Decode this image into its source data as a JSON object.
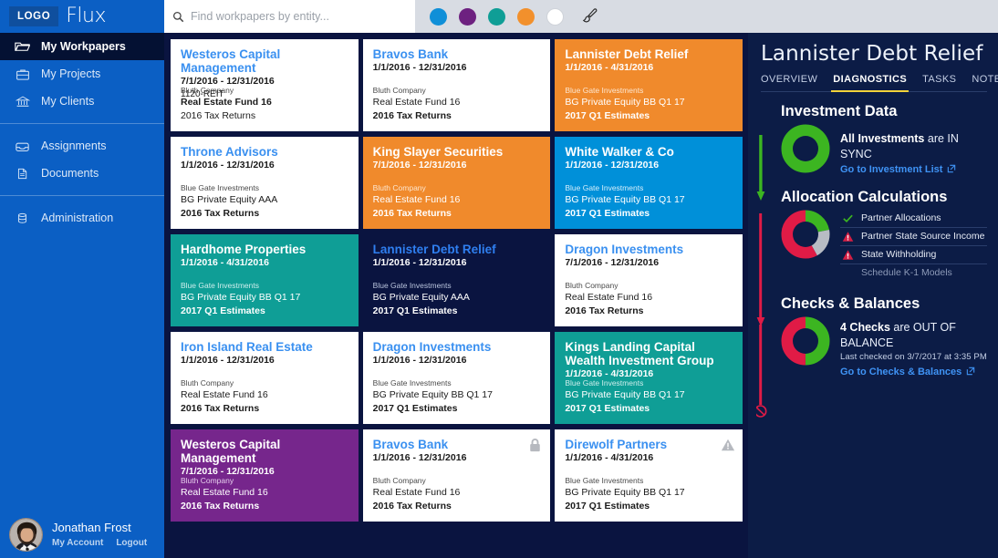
{
  "topbar": {
    "logo_label": "LOGO",
    "brand_name": "Flux",
    "search": {
      "placeholder": "Find workpapers by entity...",
      "value": "",
      "icon": "search-icon"
    },
    "swatches": [
      {
        "name": "swatch-blue",
        "color": "#0f8fd8"
      },
      {
        "name": "swatch-purple",
        "color": "#6d2180"
      },
      {
        "name": "swatch-teal",
        "color": "#0f9e96"
      },
      {
        "name": "swatch-orange",
        "color": "#f2902c"
      },
      {
        "name": "swatch-white",
        "color": "#ffffff"
      }
    ],
    "brush_icon": "paintbrush-icon"
  },
  "sidebar": {
    "items": [
      {
        "label": "My Workpapers",
        "icon": "folder-icon",
        "active": true
      },
      {
        "label": "My Projects",
        "icon": "briefcase-icon",
        "active": false
      },
      {
        "label": "My Clients",
        "icon": "bank-icon",
        "active": false
      },
      {
        "label": "Assignments",
        "icon": "inbox-icon",
        "active": false
      },
      {
        "label": "Documents",
        "icon": "document-icon",
        "active": false
      },
      {
        "label": "Administration",
        "icon": "database-icon",
        "active": false
      }
    ],
    "profile": {
      "name": "Jonathan Frost",
      "account_link": "My Account",
      "logout_link": "Logout"
    }
  },
  "cards": [
    {
      "title": "Westeros Capital Management",
      "dates": "7/1/2016 - 12/31/2016",
      "sub": "1120-REIT",
      "m1": "Bluth Company",
      "m2": "Real Estate Fund 16",
      "m3": "2016 Tax Returns",
      "theme": "t-white",
      "bold": "m2",
      "icon": ""
    },
    {
      "title": "Bravos Bank",
      "dates": "1/1/2016 - 12/31/2016",
      "sub": "",
      "m1": "Bluth Company",
      "m2": "Real Estate Fund 16",
      "m3": "2016 Tax Returns",
      "theme": "t-white",
      "bold": "m3",
      "icon": ""
    },
    {
      "title": "Lannister Debt Relief",
      "dates": "1/1/2016 - 4/31/2016",
      "sub": "",
      "m1": "Blue Gate Investments",
      "m2": "BG Private Equity BB Q1 17",
      "m3": "2017 Q1 Estimates",
      "theme": "t-orange",
      "bold": "m3",
      "icon": ""
    },
    {
      "title": "Throne Advisors",
      "dates": "1/1/2016 - 12/31/2016",
      "sub": "",
      "m1": "Blue Gate Investments",
      "m2": "BG Private Equity AAA",
      "m3": "2016 Tax Returns",
      "theme": "t-white",
      "bold": "m3",
      "icon": ""
    },
    {
      "title": "King Slayer Securities",
      "dates": "7/1/2016 - 12/31/2016",
      "sub": "",
      "m1": "Bluth Company",
      "m2": "Real Estate Fund 16",
      "m3": "2016 Tax Returns",
      "theme": "t-orange",
      "bold": "m3",
      "icon": ""
    },
    {
      "title": "White Walker & Co",
      "dates": "1/1/2016 - 12/31/2016",
      "sub": "",
      "m1": "Blue Gate Investments",
      "m2": "BG Private Equity BB Q1 17",
      "m3": "2017 Q1 Estimates",
      "theme": "t-blue",
      "bold": "m3",
      "icon": ""
    },
    {
      "title": "Hardhome Properties",
      "dates": "1/1/2016 - 4/31/2016",
      "sub": "",
      "m1": "Blue Gate Investments",
      "m2": "BG Private Equity BB Q1 17",
      "m3": "2017 Q1 Estimates",
      "theme": "t-teal",
      "bold": "m3",
      "icon": ""
    },
    {
      "title": "Lannister Debt Relief",
      "dates": "1/1/2016 - 12/31/2016",
      "sub": "",
      "m1": "Blue Gate Investments",
      "m2": "BG Private Equity AAA",
      "m3": "2017 Q1 Estimates",
      "theme": "t-navy",
      "bold": "m3",
      "icon": ""
    },
    {
      "title": "Dragon Investments",
      "dates": "7/1/2016 - 12/31/2016",
      "sub": "",
      "m1": "Bluth Company",
      "m2": "Real Estate Fund 16",
      "m3": "2016 Tax Returns",
      "theme": "t-white",
      "bold": "m3",
      "icon": ""
    },
    {
      "title": "Iron Island Real Estate",
      "dates": "1/1/2016 - 12/31/2016",
      "sub": "",
      "m1": "Bluth Company",
      "m2": "Real Estate Fund 16",
      "m3": "2016 Tax Returns",
      "theme": "t-white",
      "bold": "m3",
      "icon": ""
    },
    {
      "title": "Dragon Investments",
      "dates": "1/1/2016 - 12/31/2016",
      "sub": "",
      "m1": "Blue Gate Investments",
      "m2": "BG Private Equity BB Q1 17",
      "m3": "2017 Q1 Estimates",
      "theme": "t-white",
      "bold": "m3",
      "icon": ""
    },
    {
      "title": "Kings Landing Capital Wealth Investment Group",
      "dates": "1/1/2016 - 4/31/2016",
      "sub": "",
      "m1": "Blue Gate Investments",
      "m2": "BG Private Equity BB Q1 17",
      "m3": "2017 Q1 Estimates",
      "theme": "t-teal",
      "bold": "m3",
      "icon": ""
    },
    {
      "title": "Westeros Capital Management",
      "dates": "7/1/2016 - 12/31/2016",
      "sub": "",
      "m1": "Bluth Company",
      "m2": "Real Estate Fund 16",
      "m3": "2016 Tax Returns",
      "theme": "t-purple",
      "bold": "m3",
      "icon": ""
    },
    {
      "title": "Bravos Bank",
      "dates": "1/1/2016 - 12/31/2016",
      "sub": "",
      "m1": "Bluth Company",
      "m2": "Real Estate Fund 16",
      "m3": "2016 Tax Returns",
      "theme": "t-white",
      "bold": "m3",
      "icon": "lock-icon"
    },
    {
      "title": "Direwolf Partners",
      "dates": "1/1/2016 - 4/31/2016",
      "sub": "",
      "m1": "Blue Gate Investments",
      "m2": "BG Private Equity BB Q1 17",
      "m3": "2017 Q1 Estimates",
      "theme": "t-white",
      "bold": "m3",
      "icon": "warning-icon"
    }
  ],
  "detail": {
    "title": "Lannister Debt Relief",
    "tabs": [
      {
        "label": "OVERVIEW",
        "active": false
      },
      {
        "label": "DIAGNOSTICS",
        "active": true
      },
      {
        "label": "TASKS",
        "active": false
      },
      {
        "label": "NOTES",
        "active": false
      }
    ],
    "investment_data": {
      "heading": "Investment Data",
      "lead_strong": "All Investments",
      "lead_rest": " are IN SYNC",
      "link": "Go to Investment List",
      "link_icon": "external-link-icon",
      "donut": {
        "segments": [
          {
            "color": "#3cb521",
            "pct": 100
          }
        ]
      },
      "status_color": "#3cb521"
    },
    "allocation": {
      "heading": "Allocation Calculations",
      "donut": {
        "segments": [
          {
            "color": "#3cb521",
            "pct": 22
          },
          {
            "color": "#b8bcc4",
            "pct": 20
          },
          {
            "color": "#e01b46",
            "pct": 58
          }
        ]
      },
      "rows": [
        {
          "label": "Partner Allocations",
          "icon": "check-icon",
          "state": "ok"
        },
        {
          "label": "Partner State Source Income",
          "icon": "warning-icon",
          "state": "error"
        },
        {
          "label": "State Withholding",
          "icon": "warning-icon",
          "state": "error"
        },
        {
          "label": "Schedule K-1 Models",
          "icon": "",
          "state": "muted"
        }
      ],
      "status_color": "#e01b46"
    },
    "checks": {
      "heading": "Checks & Balances",
      "lead_strong": "4 Checks",
      "lead_rest": " are OUT OF BALANCE",
      "subnote": "Last checked on  3/7/2017 at  3:35 PM",
      "link": "Go to Checks & Balances",
      "link_icon": "external-link-icon",
      "donut": {
        "segments": [
          {
            "color": "#3cb521",
            "pct": 50
          },
          {
            "color": "#e01b46",
            "pct": 50
          }
        ]
      },
      "status_color": "#e01b46",
      "end_icon": "blocked-icon"
    }
  }
}
